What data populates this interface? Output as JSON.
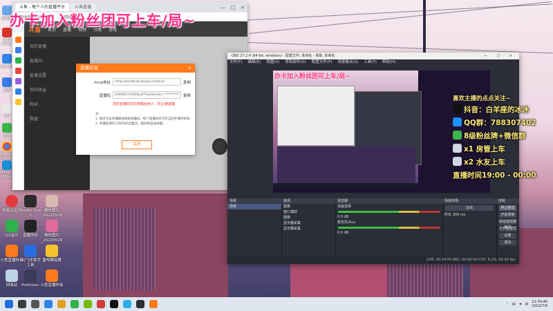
{
  "overlay_title": "办卡加入粉丝团可上车/局~",
  "browser": {
    "tabs": [
      "斗鱼 - 每个人的直播平台",
      "斗鱼直播"
    ],
    "address": [
      "快速收藏",
      "斗鱼官网",
      "上网导航"
    ],
    "nav_items": [
      "首页",
      "直播",
      "视频",
      "分类",
      "游戏"
    ],
    "side_menu": [
      "我的直播",
      "直播间",
      "直播设置",
      "我的收益",
      "粉丝",
      "数据"
    ]
  },
  "dialog": {
    "title": "直播信息",
    "close": "×",
    "rtmp_label": "rtmp地址",
    "rtmp_value": "rtmp://sendtc3a.douyu.com/live",
    "rtmp_copy": "复制",
    "code_label": "直播码",
    "code_value": "10490174rZG0yaf7?wsSecret=**********",
    "code_copy": "复制",
    "warning": "您的直播码切勿泄露给他人，防止被盗播",
    "tip_header": "注：",
    "tip1": "1. 每次点击开播都会刷新直播码，每个直播码仅可在当前开播时有效。",
    "tip2": "2. 开播后请在15秒内开启推流，超时将自动关播。",
    "button": "关闭"
  },
  "obs": {
    "title": "OBS 27.2.4 (64-bit, windows) - 配置文件: 未命名 - 场景: 未命名",
    "window_controls": [
      "—",
      "□",
      "×"
    ],
    "menu": [
      "文件(F)",
      "编辑(E)",
      "视图(V)",
      "停靠部件(D)",
      "配置文件(P)",
      "场景集合(S)",
      "工具(T)",
      "帮助(H)"
    ],
    "preview_text": "办卡加入粉丝团可上车/局~",
    "docks": {
      "scenes": {
        "title": "场景",
        "items": [
          "场景"
        ]
      },
      "sources": {
        "title": "来源",
        "items": [
          "图像",
          "窗口捕获",
          "图像",
          "显示器采集",
          "显示器采集"
        ]
      },
      "mixer": {
        "title": "混音器",
        "tracks": [
          "桌面音频",
          "麦克风/Aux"
        ],
        "levels": [
          "0.0 dB",
          "0.0 dB"
        ]
      },
      "transitions": {
        "title": "场景转场",
        "type": "淡出",
        "duration_label": "时长",
        "duration": "300 ms"
      },
      "controls": {
        "title": "控制",
        "buttons": [
          "停止推流",
          "开始录制",
          "启动虚拟摄像机",
          "工作室模式",
          "设置",
          "退出"
        ]
      }
    },
    "status": "LIVE: 00:24:05   REC: 00:00:00   CPU: 9.2%, 60.00 fps"
  },
  "stream_info": {
    "header": "喜欢主播的点点关注~",
    "douyin": "抖音：白羊座的冰冰",
    "qq": "QQ群：788307402",
    "fans": "8级粉丝牌+微信群",
    "x1": "x1 房管上车",
    "x2": "x2 水友上车",
    "time": "直播时间19:00 - 00:00"
  },
  "desktop_icons": [
    "网易云音乐",
    "Studio One 5",
    "微信图片_20220526",
    "QQ音乐",
    "直播伴侣",
    "微信图片_20220526",
    "斗鱼直播伴侣",
    "QQ飞车助手工具",
    "雷电模拟器",
    "回收站",
    "ProDriver",
    "斗鱼直播伴侣"
  ],
  "left_icons": [
    "此电脑",
    "WPS Office",
    "QQ飞车",
    "迅雷",
    "QQ",
    "微信",
    "Google Chrome",
    "Microsoft Edge",
    "Internet Explorer"
  ],
  "taskbar": {
    "time": "21:59:46",
    "date": "2022/7/4",
    "lang": "中"
  },
  "colors": {
    "accent": "#ff7a1c",
    "overlay_pink": "#ff2f8b",
    "info_yellow": "#ffea7a"
  }
}
